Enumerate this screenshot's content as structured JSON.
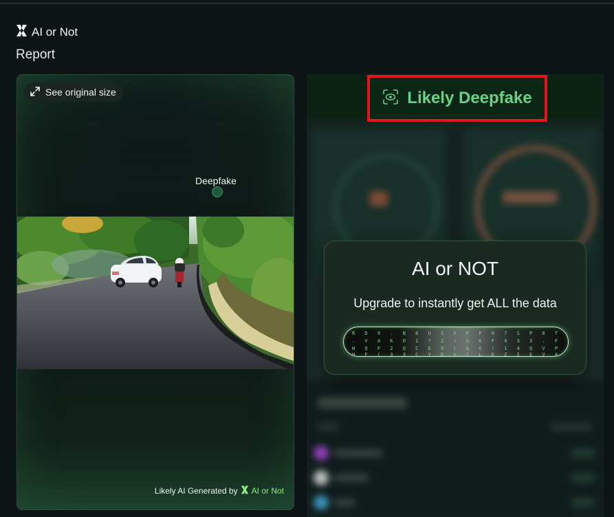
{
  "brand": {
    "name": "AI or Not",
    "logo_icon": "ai-or-not-logo-icon"
  },
  "page_title": "Report",
  "preview": {
    "see_original_label": "See original size",
    "detection_label": "Deepfake",
    "watermark_prefix": "Likely AI Generated by",
    "watermark_brand": "AI or Not"
  },
  "result": {
    "verdict": "Likely Deepfake",
    "verdict_icon": "face-scan-icon",
    "upgrade": {
      "title": "AI or NOT",
      "text": "Upgrade to instantly get ALL the data"
    }
  },
  "colors": {
    "background": "#0c1415",
    "accent_green": "#62d389",
    "highlight_red": "#e6141b",
    "brand_green": "#8df07a"
  }
}
